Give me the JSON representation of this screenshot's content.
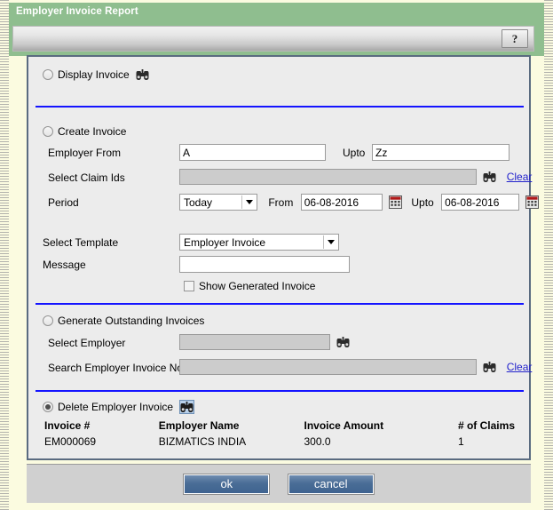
{
  "window": {
    "title": "Employer Invoice Report",
    "help_label": "?"
  },
  "sections": {
    "display_invoice": {
      "radio_label": "Display Invoice",
      "selected": false,
      "lookup_icon": "binoculars-icon"
    },
    "create_invoice": {
      "radio_label": "Create Invoice",
      "selected": false,
      "employer_from_label": "Employer From",
      "employer_from_value": "A",
      "employer_upto_label": "Upto",
      "employer_upto_value": "Zz",
      "select_claim_ids_label": "Select Claim Ids",
      "select_claim_ids_value": "",
      "select_claim_ids_clear": "Clear",
      "period_label": "Period",
      "period_value": "Today",
      "period_options": [
        "Today"
      ],
      "from_label": "From",
      "from_value": "06-08-2016",
      "upto_label": "Upto",
      "upto_value": "06-08-2016",
      "select_template_label": "Select Template",
      "select_template_value": "Employer Invoice",
      "select_template_options": [
        "Employer Invoice"
      ],
      "message_label": "Message",
      "message_value": "",
      "show_generated_label": "Show Generated Invoice",
      "show_generated_checked": false
    },
    "generate_outstanding": {
      "radio_label": "Generate Outstanding Invoices",
      "selected": false,
      "select_employer_label": "Select Employer",
      "select_employer_value": "",
      "search_invoice_nos_label": "Search Employer Invoice Nos",
      "search_invoice_nos_value": "",
      "search_invoice_nos_clear": "Clear"
    },
    "delete_invoice": {
      "radio_label": "Delete Employer Invoice",
      "selected": true,
      "table": {
        "columns": [
          "Invoice #",
          "Employer Name",
          "Invoice Amount",
          "# of Claims"
        ],
        "rows": [
          [
            "EM000069",
            "BIZMATICS INDIA",
            "300.0",
            "1"
          ]
        ]
      }
    }
  },
  "footer": {
    "ok_label": "ok",
    "cancel_label": "cancel"
  },
  "colors": {
    "titlebar": "#8fbe8f",
    "separator": "#1414ff",
    "button": "#4a6d96",
    "link": "#2222cc",
    "panel": "#ececec",
    "page_backdrop": "#fbfbe0"
  }
}
